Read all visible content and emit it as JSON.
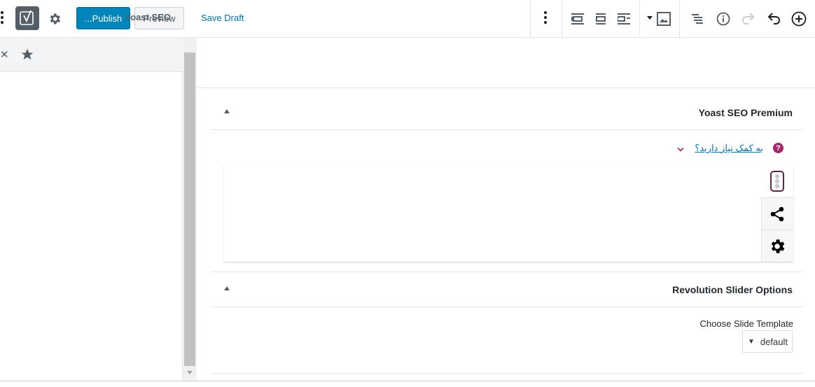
{
  "toolbar": {
    "publish_label": "...Publish",
    "preview_label": "Preview",
    "save_draft_label": "Save Draft",
    "yoast_logo_letter": "y"
  },
  "sidebar": {
    "close_glyph": "✕",
    "title": "Yoast SEO"
  },
  "yoast_panel": {
    "title": "Yoast SEO Premium",
    "help_link": "به کمک نیاز دارید؟",
    "help_icon_glyph": "?"
  },
  "revslider_panel": {
    "title": "Revolution Slider Options",
    "template_label": "Choose Slide Template",
    "template_value": "default",
    "select_arrow": "▼"
  },
  "colors": {
    "primary": "#0085ba",
    "yoast_purple": "#a4286a",
    "link": "#0073aa"
  }
}
